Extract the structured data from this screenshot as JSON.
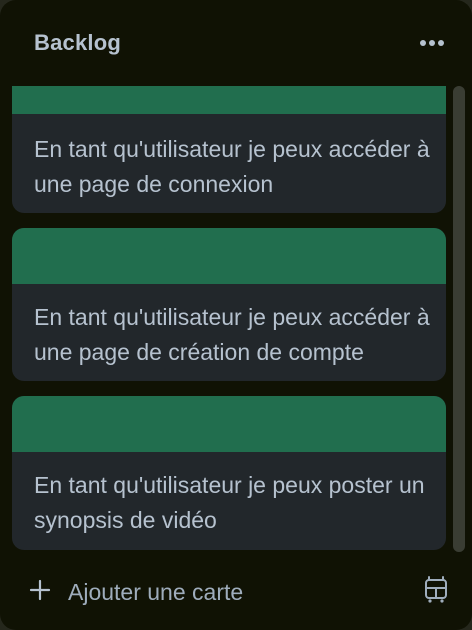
{
  "list": {
    "title": "Backlog",
    "more_icon": "more-horizontal-icon"
  },
  "cards": [
    {
      "text": "En tant qu'utilisateur je peux accéder à une page de connexion",
      "cover_color": "#216e4e"
    },
    {
      "text": "En tant qu'utilisateur je peux accéder à une page de création de compte",
      "cover_color": "#216e4e"
    },
    {
      "text": "En tant qu'utilisateur je peux poster un synopsis de vidéo",
      "cover_color": "#216e4e"
    }
  ],
  "footer": {
    "add_card_label": "Ajouter une carte",
    "add_icon": "plus-icon",
    "template_icon": "card-template-icon"
  },
  "colors": {
    "list_background": "#101204",
    "card_background": "#22272b",
    "text": "#b6c2cf",
    "muted_text": "#9fadbc"
  }
}
